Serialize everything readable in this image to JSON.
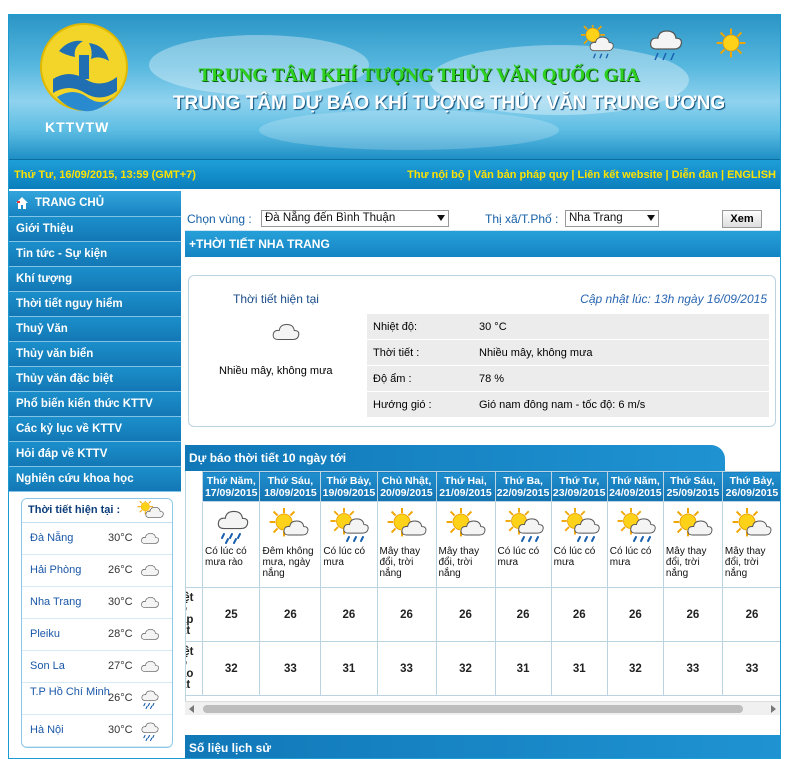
{
  "header": {
    "logo_text": "KTTVTW",
    "title_line1": "TRUNG TÂM KHÍ TƯỢNG THỦY VĂN QUỐC GIA",
    "title_line2": "TRUNG TÂM DỰ BÁO KHÍ TƯỢNG THỦY VĂN TRUNG ƯƠNG"
  },
  "topbar": {
    "datetime": "Thứ Tư, 16/09/2015, 13:59 (GMT+7)",
    "links": [
      "Thư nội bộ",
      "Văn bản pháp quy",
      "Liên kết website",
      "Diễn đàn",
      "ENGLISH"
    ]
  },
  "sidebar": {
    "home_label": "TRANG CHỦ",
    "items": [
      "Giới Thiệu",
      "Tin tức - Sự kiện",
      "Khí tượng",
      "Thời tiết nguy hiểm",
      "Thuỷ Văn",
      "Thủy văn biển",
      "Thủy văn đặc biệt",
      "Phổ biến kiến thức KTTV",
      "Các kỷ lục về KTTV",
      "Hỏi đáp về KTTV",
      "Nghiên cứu khoa học"
    ],
    "current_title": "Thời tiết hiện tại :",
    "cities": [
      {
        "name": "Đà Nẵng",
        "temp": "30°C",
        "icon": "cloud-icon"
      },
      {
        "name": "Hải Phòng",
        "temp": "26°C",
        "icon": "cloud-icon"
      },
      {
        "name": "Nha Trang",
        "temp": "30°C",
        "icon": "cloud-icon"
      },
      {
        "name": "Pleiku",
        "temp": "28°C",
        "icon": "cloud-icon"
      },
      {
        "name": "Son La",
        "temp": "27°C",
        "icon": "cloud-icon"
      },
      {
        "name": "T.P Hồ Chí Minh",
        "temp": "26°C",
        "icon": "rain-cloud-icon"
      },
      {
        "name": "Hà Nội",
        "temp": "30°C",
        "icon": "rain-cloud-icon"
      }
    ]
  },
  "selector": {
    "region_label": "Chọn vùng :",
    "region_value": "Đà Nẵng đến Bình Thuận",
    "city_label": "Thị xã/T.Phố :",
    "city_value": "Nha Trang",
    "submit_label": "Xem"
  },
  "location_title": "+THỜI TIẾT  NHA TRANG",
  "current": {
    "title": "Thời tiết hiện tại",
    "description": "Nhiều mây, không mưa",
    "updated": "Cập nhật lúc: 13h ngày 16/09/2015",
    "rows": [
      {
        "key": "Nhiệt độ:",
        "value": "30 °C"
      },
      {
        "key": "Thời tiết :",
        "value": "Nhiều mây, không mưa"
      },
      {
        "key": "Độ ẩm :",
        "value": "78 %"
      },
      {
        "key": "Hướng gió :",
        "value": "Gió nam đông nam - tốc độ: 6 m/s"
      }
    ]
  },
  "forecast": {
    "title": "Dự báo thời tiết 10 ngày tới",
    "row_labels": [
      "t",
      "iệt\nộ\nấp\nất",
      "iệt\nộ\nao\nất"
    ],
    "days": [
      {
        "day": "Thứ Năm,",
        "date": "17/09/2015",
        "icon": "rain-cloud-icon",
        "desc": "Có lúc có mưa rào",
        "low": "25",
        "high": "32"
      },
      {
        "day": "Thứ Sáu,",
        "date": "18/09/2015",
        "icon": "sun-cloud-icon",
        "desc": "Đêm không mưa, ngày nắng",
        "low": "26",
        "high": "33"
      },
      {
        "day": "Thứ Bảy,",
        "date": "19/09/2015",
        "icon": "sun-rain-icon",
        "desc": "Có lúc có mưa",
        "low": "26",
        "high": "31"
      },
      {
        "day": "Chủ Nhật,",
        "date": "20/09/2015",
        "icon": "sun-cloud-icon",
        "desc": "Mây thay đổi, trời nắng",
        "low": "26",
        "high": "33"
      },
      {
        "day": "Thứ Hai,",
        "date": "21/09/2015",
        "icon": "sun-cloud-icon",
        "desc": "Mây thay đổi, trời nắng",
        "low": "26",
        "high": "32"
      },
      {
        "day": "Thứ Ba,",
        "date": "22/09/2015",
        "icon": "sun-rain-icon",
        "desc": "Có lúc có mưa",
        "low": "26",
        "high": "31"
      },
      {
        "day": "Thứ Tư,",
        "date": "23/09/2015",
        "icon": "sun-rain-icon",
        "desc": "Có lúc có mưa",
        "low": "26",
        "high": "31"
      },
      {
        "day": "Thứ Năm,",
        "date": "24/09/2015",
        "icon": "sun-rain-icon",
        "desc": "Có lúc có mưa",
        "low": "26",
        "high": "32"
      },
      {
        "day": "Thứ Sáu,",
        "date": "25/09/2015",
        "icon": "sun-cloud-icon",
        "desc": "Mây thay đổi, trời nắng",
        "low": "26",
        "high": "33"
      },
      {
        "day": "Thứ Bảy,",
        "date": "26/09/2015",
        "icon": "sun-cloud-icon",
        "desc": "Mây thay đổi, trời nắng",
        "low": "26",
        "high": "33"
      }
    ]
  },
  "history_title": "Số liệu lịch sử",
  "colors": {
    "accent": "#1584c4",
    "header_green": "#2ed11f",
    "link_yellow": "#ffe200"
  }
}
